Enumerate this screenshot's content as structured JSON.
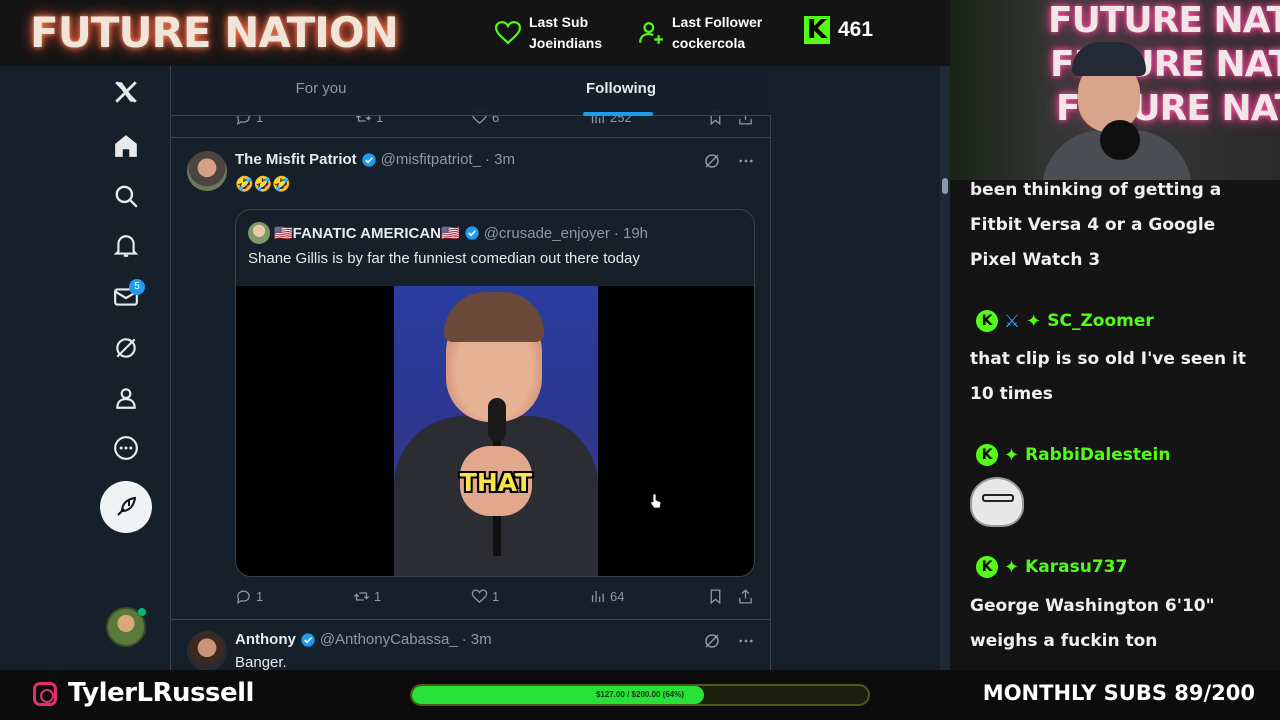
{
  "overlay": {
    "brand": "FUTURE NATION",
    "last_sub_label": "Last Sub",
    "last_sub_name": "Joeindians",
    "last_follower_label": "Last Follower",
    "last_follower_name": "cockercola",
    "kick_count": "461",
    "instagram_handle": "TylerLRussell",
    "goal_text": "$127.00 / $200.00 (64%)",
    "goal_progress": 0.64,
    "monthly_subs": "MONTHLY SUBS 89/200"
  },
  "nav": {
    "logo": "X",
    "items": [
      "home-icon",
      "search-icon",
      "bell-icon",
      "mail-icon",
      "grok-icon",
      "profile-icon",
      "more-icon"
    ],
    "messages_badge": "5"
  },
  "tabs": [
    {
      "label": "For you",
      "active": false
    },
    {
      "label": "Following",
      "active": true
    }
  ],
  "prev_tweet_actions": {
    "replies": "1",
    "reposts": "1",
    "likes": "6",
    "views": "252"
  },
  "tweets": [
    {
      "name": "The Misfit Patriot",
      "handle": "@misfitpatriot_",
      "time": "· 3m",
      "text": "🤣🤣🤣",
      "quote": {
        "name": "🇺🇸FANATIC AMERICAN🇺🇸",
        "handle": "@crusade_enjoyer",
        "time": "· 19h",
        "text": "Shane Gillis is by far the funniest comedian out there today",
        "video_caption": "THAT"
      },
      "actions": {
        "replies": "1",
        "reposts": "1",
        "likes": "1",
        "views": "64"
      }
    },
    {
      "name": "Anthony",
      "handle": "@AnthonyCabassa_",
      "time": "· 3m",
      "text": "Banger."
    }
  ],
  "webcam": {
    "neon_text": "FUTURE NATION"
  },
  "chat": [
    {
      "type": "text",
      "text": "been thinking of getting a Fitbit Versa 4 or a Google Pixel Watch 3"
    },
    {
      "type": "user",
      "name": "SC_Zoomer"
    },
    {
      "type": "text",
      "text": "that clip is so old I've seen it 10 times"
    },
    {
      "type": "user",
      "name": "RabbiDalestein"
    },
    {
      "type": "user",
      "name": "Karasu737"
    },
    {
      "type": "text",
      "text": "George Washington 6'10\" weighs a fuckin ton"
    }
  ],
  "colors": {
    "accent": "#1d9bf0",
    "kick_green": "#53fc18",
    "x_bg": "#15202b"
  }
}
